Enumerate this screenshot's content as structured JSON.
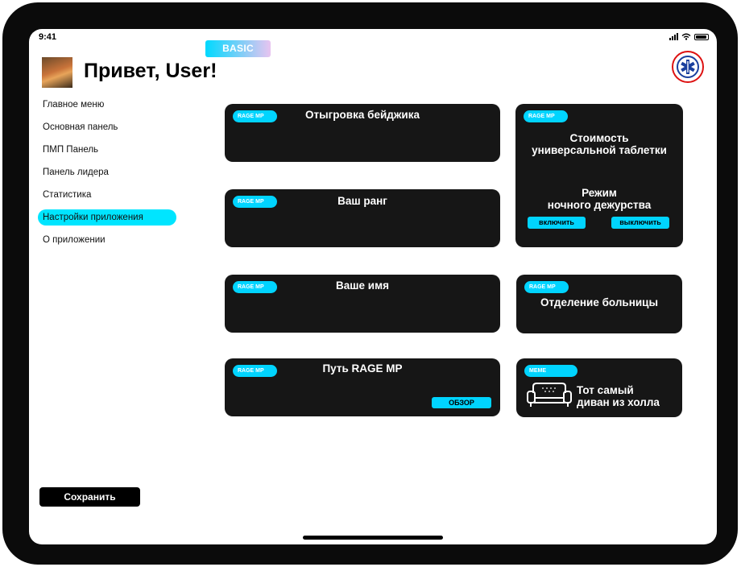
{
  "status": {
    "time": "9:41"
  },
  "header": {
    "tier_badge": "BASIC",
    "greeting": "Привет, User!"
  },
  "sidebar": {
    "items": [
      {
        "label": "Главное меню"
      },
      {
        "label": "Основная панель"
      },
      {
        "label": "ПМП Панель"
      },
      {
        "label": "Панель лидера"
      },
      {
        "label": "Статистика"
      },
      {
        "label": "Настройки приложения",
        "active": true
      },
      {
        "label": "О приложении"
      }
    ],
    "save_label": "Сохранить"
  },
  "cards": {
    "badge": {
      "tag": "RAGE MP",
      "title": "Отыгровка бейджика"
    },
    "rank": {
      "tag": "RAGE MP",
      "title": "Ваш ранг"
    },
    "name": {
      "tag": "RAGE MP",
      "title": "Ваше имя"
    },
    "path": {
      "tag": "RAGE MP",
      "title": "Путь RAGE MP",
      "button": "ОБЗОР"
    },
    "pill": {
      "tag": "RAGE MP",
      "title_line1": "Стоимость",
      "title_line2": "универсальной таблетки",
      "night_line1": "Режим",
      "night_line2": "ночного дежурства",
      "on_label": "включить",
      "off_label": "выключить"
    },
    "department": {
      "tag": "RAGE MP",
      "title": "Отделение больницы"
    },
    "sofa": {
      "tag": "MEME",
      "title_line1": "Тот самый",
      "title_line2": "диван из холла"
    }
  },
  "colors": {
    "accent": "#00d4ff",
    "card_bg": "#161616",
    "active_nav": "#00e5ff"
  },
  "icons": {
    "logo": "emergency-medical-services-logo",
    "sofa": "sofa-icon"
  }
}
